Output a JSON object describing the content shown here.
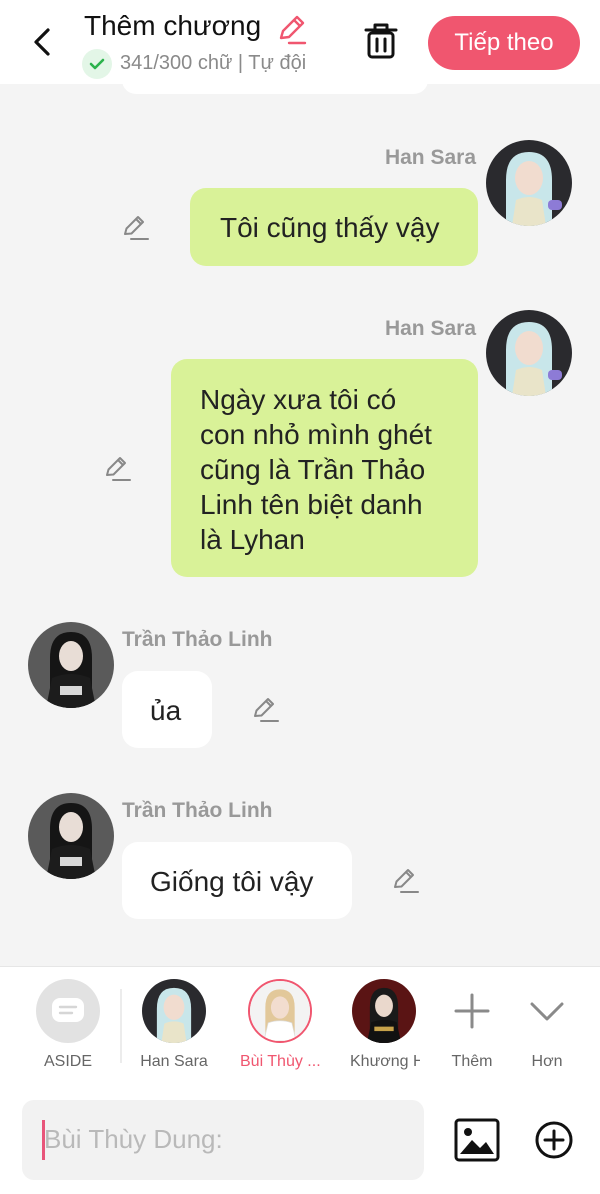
{
  "header": {
    "title": "Thêm chương",
    "word_count": "341/300 chữ | Tự đội",
    "next_label": "Tiếp theo"
  },
  "messages": [
    {
      "sender": "Han Sara",
      "side": "right",
      "text": "Tôi cũng thấy vậy"
    },
    {
      "sender": "Han Sara",
      "side": "right",
      "lines": [
        "Ngày xưa tôi có",
        "con nhỏ mình ghét",
        "cũng là Trần Thảo",
        "Linh tên biệt danh",
        "là Lyhan"
      ]
    },
    {
      "sender": "Trần Thảo Linh",
      "side": "left",
      "text": "ủa"
    },
    {
      "sender": "Trần Thảo Linh",
      "side": "left",
      "text": "Giống tôi vậy"
    }
  ],
  "characters": [
    {
      "label": "ASIDE",
      "selected": false
    },
    {
      "label": "Han Sara",
      "selected": false
    },
    {
      "label": "Bùi Thùy ...",
      "selected": true
    },
    {
      "label": "Khương H",
      "selected": false
    },
    {
      "label": "Thêm"
    },
    {
      "label": "Hơn"
    }
  ],
  "input": {
    "placeholder": "Bùi Thùy Dung:"
  },
  "colors": {
    "accent": "#f0566f",
    "my_bubble": "#d9f298",
    "their_bubble": "#ffffff",
    "background": "#f4f4f4"
  }
}
